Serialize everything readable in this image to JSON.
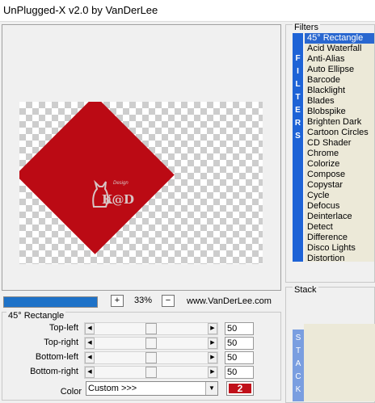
{
  "window": {
    "title": "UnPlugged-X v2.0 by VanDerLee"
  },
  "preview": {
    "watermark_text": "K@D",
    "watermark_small": "Design"
  },
  "statusbar": {
    "progress": 1.0,
    "zoom_plus": "+",
    "zoom_value": "33%",
    "zoom_minus": "−",
    "site": "www.VanDerLee.com"
  },
  "params": {
    "group_title": "45° Rectangle",
    "rows": [
      {
        "label": "Top-left",
        "value": "50"
      },
      {
        "label": "Top-right",
        "value": "50"
      },
      {
        "label": "Bottom-left",
        "value": "50"
      },
      {
        "label": "Bottom-right",
        "value": "50"
      }
    ],
    "color_label": "Color",
    "color_value": "Custom >>>",
    "color_swatch_text": "2",
    "color_swatch_hex": "#c0101a"
  },
  "filters": {
    "title": "Filters",
    "strip_letters": [
      "F",
      "I",
      "L",
      "T",
      "E",
      "R",
      "S"
    ],
    "items": [
      "45° Rectangle",
      "Acid Waterfall",
      "Anti-Alias",
      "Auto Ellipse",
      "Barcode",
      "Blacklight",
      "Blades",
      "Blobspike",
      "Brighten Dark",
      "Cartoon Circles",
      "CD Shader",
      "Chrome",
      "Colorize",
      "Compose",
      "Copystar",
      "Cycle",
      "Defocus",
      "Deinterlace",
      "Detect",
      "Difference",
      "Disco Lights",
      "Distortion"
    ],
    "selected_index": 0
  },
  "stack": {
    "title": "Stack",
    "strip_letters": [
      "S",
      "T",
      "A",
      "C",
      "K"
    ]
  }
}
